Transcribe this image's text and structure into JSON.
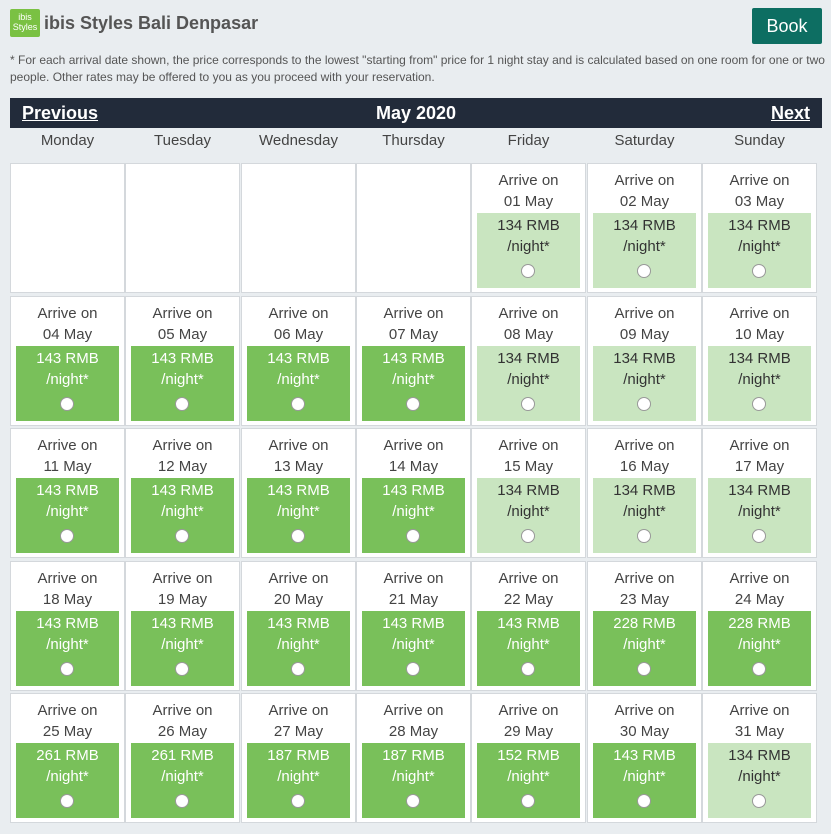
{
  "header": {
    "logo_text": "ibis Styles",
    "hotel_name": "ibis Styles Bali Denpasar",
    "book_label": "Book"
  },
  "note": "* For each arrival date shown, the price corresponds to the lowest \"starting from\" price for 1 night stay and is calculated based on one room for one or two people. Other rates may be offered to you as you proceed with your reservation.",
  "calendar": {
    "prev_label": "Previous",
    "next_label": "Next",
    "month_label": "May 2020",
    "weekdays": [
      "Monday",
      "Tuesday",
      "Wednesday",
      "Thursday",
      "Friday",
      "Saturday",
      "Sunday"
    ],
    "arrive_label": "Arrive on",
    "per_night": "/night*",
    "weeks": [
      [
        null,
        null,
        null,
        null,
        {
          "date": "01 May",
          "price": "134 RMB",
          "tone": "light"
        },
        {
          "date": "02 May",
          "price": "134 RMB",
          "tone": "light"
        },
        {
          "date": "03 May",
          "price": "134 RMB",
          "tone": "light"
        }
      ],
      [
        {
          "date": "04 May",
          "price": "143 RMB",
          "tone": "dark"
        },
        {
          "date": "05 May",
          "price": "143 RMB",
          "tone": "dark"
        },
        {
          "date": "06 May",
          "price": "143 RMB",
          "tone": "dark"
        },
        {
          "date": "07 May",
          "price": "143 RMB",
          "tone": "dark"
        },
        {
          "date": "08 May",
          "price": "134 RMB",
          "tone": "light"
        },
        {
          "date": "09 May",
          "price": "134 RMB",
          "tone": "light"
        },
        {
          "date": "10 May",
          "price": "134 RMB",
          "tone": "light"
        }
      ],
      [
        {
          "date": "11 May",
          "price": "143 RMB",
          "tone": "dark"
        },
        {
          "date": "12 May",
          "price": "143 RMB",
          "tone": "dark"
        },
        {
          "date": "13 May",
          "price": "143 RMB",
          "tone": "dark"
        },
        {
          "date": "14 May",
          "price": "143 RMB",
          "tone": "dark"
        },
        {
          "date": "15 May",
          "price": "134 RMB",
          "tone": "light"
        },
        {
          "date": "16 May",
          "price": "134 RMB",
          "tone": "light"
        },
        {
          "date": "17 May",
          "price": "134 RMB",
          "tone": "light"
        }
      ],
      [
        {
          "date": "18 May",
          "price": "143 RMB",
          "tone": "dark"
        },
        {
          "date": "19 May",
          "price": "143 RMB",
          "tone": "dark"
        },
        {
          "date": "20 May",
          "price": "143 RMB",
          "tone": "dark"
        },
        {
          "date": "21 May",
          "price": "143 RMB",
          "tone": "dark"
        },
        {
          "date": "22 May",
          "price": "143 RMB",
          "tone": "dark"
        },
        {
          "date": "23 May",
          "price": "228 RMB",
          "tone": "dark"
        },
        {
          "date": "24 May",
          "price": "228 RMB",
          "tone": "dark"
        }
      ],
      [
        {
          "date": "25 May",
          "price": "261 RMB",
          "tone": "dark"
        },
        {
          "date": "26 May",
          "price": "261 RMB",
          "tone": "dark"
        },
        {
          "date": "27 May",
          "price": "187 RMB",
          "tone": "dark"
        },
        {
          "date": "28 May",
          "price": "187 RMB",
          "tone": "dark"
        },
        {
          "date": "29 May",
          "price": "152 RMB",
          "tone": "dark"
        },
        {
          "date": "30 May",
          "price": "143 RMB",
          "tone": "dark"
        },
        {
          "date": "31 May",
          "price": "134 RMB",
          "tone": "light"
        }
      ]
    ]
  },
  "colors": {
    "book_button": "#0d6e62",
    "nav_bar": "#222b3a",
    "price_dark": "#79c05a",
    "price_light": "#c9e5c0",
    "logo": "#7ac143"
  }
}
